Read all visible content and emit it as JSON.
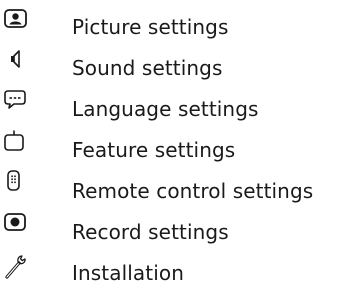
{
  "menu": {
    "items": [
      {
        "label": "Picture settings",
        "icon": "picture-settings-icon"
      },
      {
        "label": "Sound settings",
        "icon": "speaker-icon"
      },
      {
        "label": "Language settings",
        "icon": "speech-bubble-icon"
      },
      {
        "label": "Feature settings",
        "icon": "feature-box-icon"
      },
      {
        "label": "Remote control settings",
        "icon": "remote-control-icon"
      },
      {
        "label": "Record settings",
        "icon": "record-icon"
      },
      {
        "label": "Installation",
        "icon": "wrench-icon"
      }
    ]
  },
  "colors": {
    "text": "#1a1a1a",
    "icon": "#1a1a1a",
    "background": "#ffffff"
  }
}
